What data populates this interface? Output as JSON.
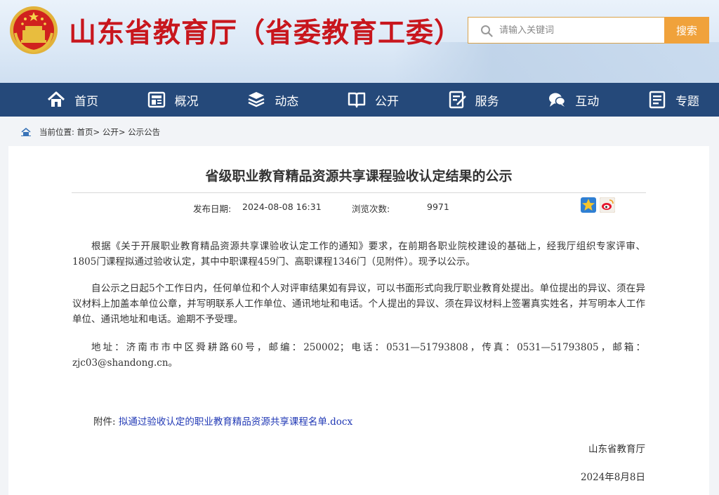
{
  "header": {
    "site_title": "山东省教育厅（省委教育工委）",
    "search": {
      "placeholder": "请输入关键词",
      "button_label": "搜索"
    }
  },
  "nav": {
    "items": [
      {
        "label": "首页",
        "icon": "home-icon"
      },
      {
        "label": "概况",
        "icon": "overview-icon"
      },
      {
        "label": "动态",
        "icon": "news-icon"
      },
      {
        "label": "公开",
        "icon": "book-icon"
      },
      {
        "label": "服务",
        "icon": "service-icon"
      },
      {
        "label": "互动",
        "icon": "chat-icon"
      },
      {
        "label": "专题",
        "icon": "topic-icon"
      }
    ]
  },
  "breadcrumb": {
    "prefix": "当前位置:",
    "items": [
      "首页",
      "公开",
      "公示公告"
    ],
    "separator": ">"
  },
  "article": {
    "title": "省级职业教育精品资源共享课程验收认定结果的公示",
    "publish_label": "发布日期:",
    "publish_date": "2024-08-08 16:31",
    "views_label": "浏览次数:",
    "views_count": "9971",
    "share_icons": [
      "qzone-icon",
      "weibo-icon"
    ],
    "paragraphs": [
      "根据《关于开展职业教育精品资源共享课验收认定工作的通知》要求，在前期各职业院校建设的基础上，经我厅组织专家评审、1805门课程拟通过验收认定，其中中职课程459门、高职课程1346门（见附件）。现予以公示。",
      "自公示之日起5个工作日内，任何单位和个人对评审结果如有异议，可以书面形式向我厅职业教育处提出。单位提出的异议、须在异议材料上加盖本单位公章，并写明联系人工作单位、通讯地址和电话。个人提出的异议、须在异议材料上签署真实姓名，并写明本人工作单位、通讯地址和电话。逾期不予受理。",
      "地址：济南市市中区舜耕路60号，邮编：250002；电话：0531—51793808，传真：0531—51793805，邮箱：zjc03@shandong.cn。"
    ],
    "attachment_label": "附件:",
    "attachment_link": "拟通过验收认定的职业教育精品资源共享课程名单.docx",
    "signature": "山东省教育厅",
    "sign_date": "2024年8月8日"
  },
  "colors": {
    "title_red": "#c8161d",
    "nav_blue": "#25497a",
    "search_orange": "#f0a23b",
    "link_blue": "#2038b5"
  }
}
